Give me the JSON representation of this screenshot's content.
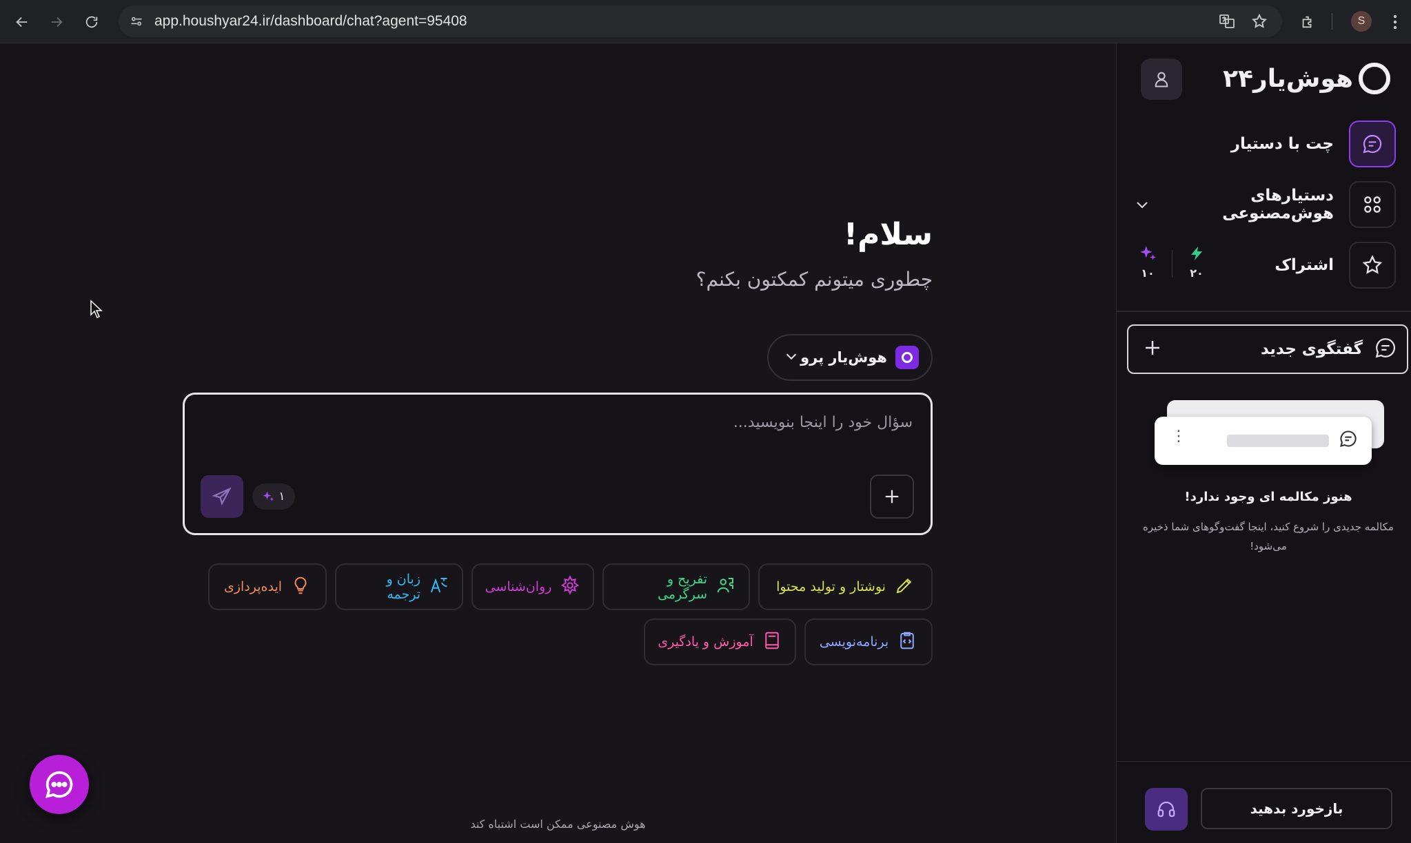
{
  "browser": {
    "url": "app.houshyar24.ir/dashboard/chat?agent=95408",
    "profile_initial": "S"
  },
  "sidebar": {
    "logo_text": "هوش‌یار۲۴",
    "items": [
      {
        "label": "چت با دستیار",
        "icon": "chat-bubble-icon",
        "active": true
      },
      {
        "label": "دستیارهای هوش‌مصنوعی",
        "icon": "grid-icon"
      },
      {
        "label": "اشتراک",
        "icon": "star-icon"
      }
    ],
    "stats": {
      "bolt": "۲۰",
      "sparkle": "۱۰"
    },
    "new_chat_label": "گفتگوی جدید",
    "empty_title": "هنوز مکالمه ای وجود ندارد!",
    "empty_desc": "مکالمه جدیدی را شروع کنید، اینجا گفت‌وگوهای شما ذخیره می‌شود!",
    "feedback_label": "بازخورد بدهید"
  },
  "main": {
    "greeting_title": "سلام!",
    "greeting_sub": "چطوری میتونم کمکتون بکنم؟",
    "model_label": "هوش‌یار پرو",
    "composer_placeholder": "سؤال خود را اینجا بنویسید...",
    "credit_count": "۱",
    "chips": [
      {
        "label": "نوشتار و تولید محتوا",
        "color": "#d8e24a",
        "icon": "pencil-icon"
      },
      {
        "label": "تفریح و سرگرمی",
        "color": "#3fd68a",
        "icon": "puzzle-people-icon"
      },
      {
        "label": "روان‌شناسی",
        "color": "#d23bd6",
        "icon": "gear-flower-icon"
      },
      {
        "label": "زبان و ترجمه",
        "color": "#33b8f2",
        "icon": "translate-icon"
      },
      {
        "label": "ایده‌پردازی",
        "color": "#f28a5a",
        "icon": "lightbulb-icon"
      },
      {
        "label": "برنامه‌نویسی",
        "color": "#8fa8ff",
        "icon": "code-clipboard-icon"
      },
      {
        "label": "آموزش و یادگیری",
        "color": "#ff5aa8",
        "icon": "book-icon"
      }
    ],
    "footer_note": "هوش مصنوعی ممکن است اشتباه کند"
  },
  "colors": {
    "accent": "#8f3df2",
    "fab": "#b81fd8",
    "bolt": "#2ecf8a",
    "sparkle": "#a64cf5"
  }
}
